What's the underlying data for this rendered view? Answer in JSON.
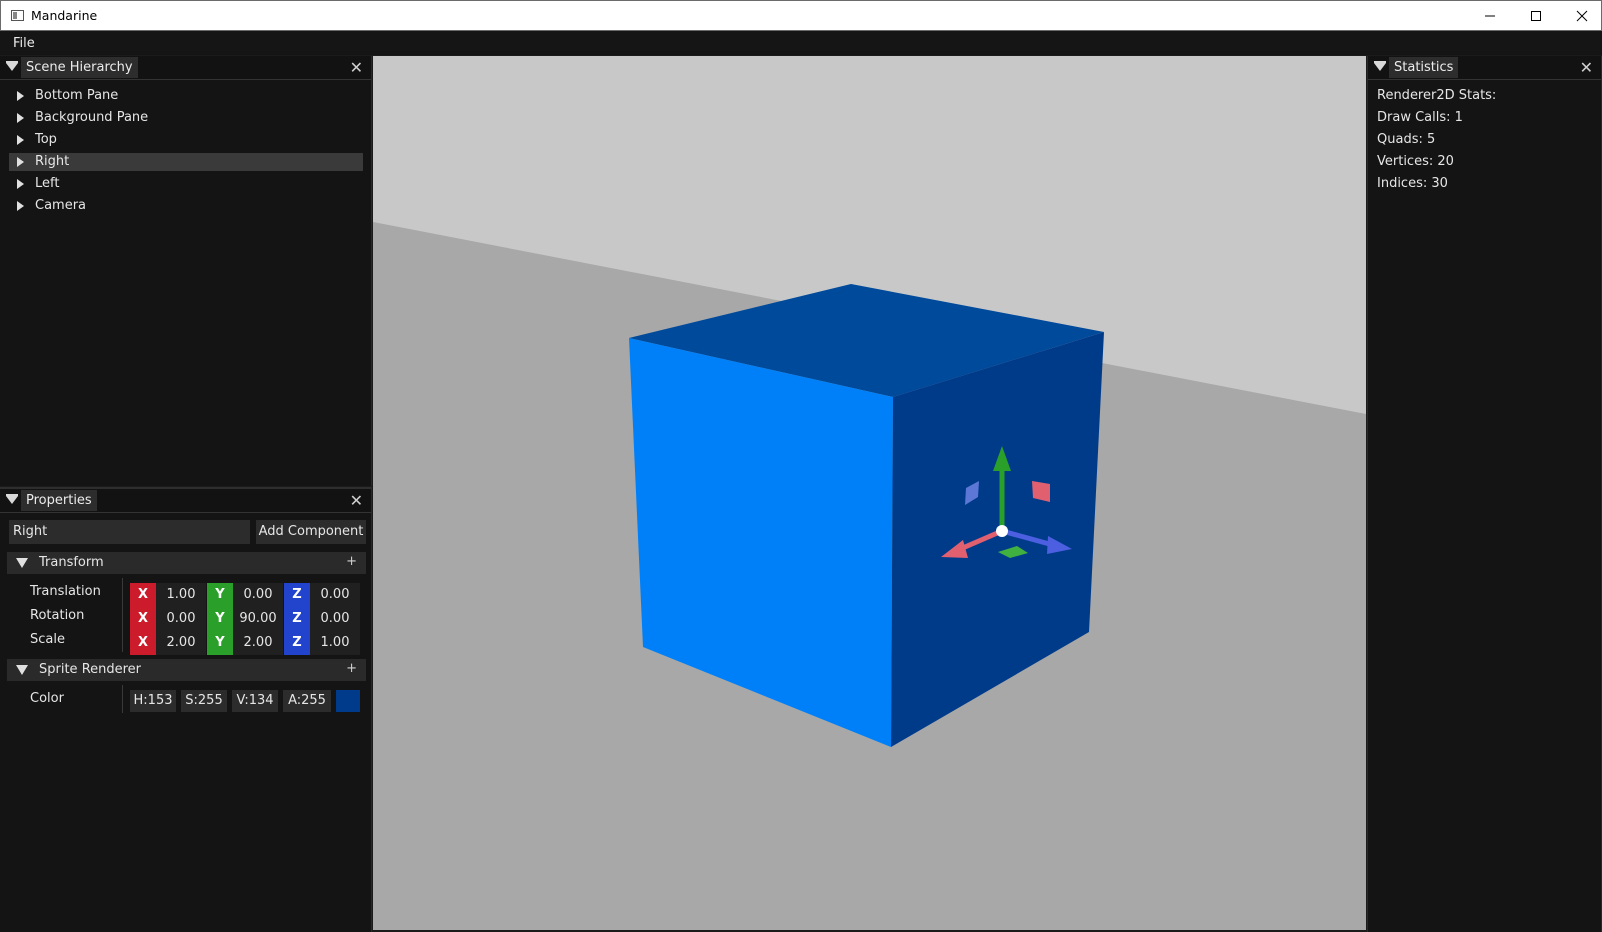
{
  "window": {
    "title": "Mandarine"
  },
  "menu": [
    "File"
  ],
  "scene_hierarchy": {
    "title": "Scene Hierarchy",
    "items": [
      "Bottom Pane",
      "Background Pane",
      "Top",
      "Right",
      "Left",
      "Camera"
    ],
    "selected": "Right"
  },
  "properties": {
    "title": "Properties",
    "entity_name": "Right",
    "add_component": "Add Component",
    "transform": {
      "label": "Transform",
      "plus": "+",
      "axis_labels": [
        "X",
        "Y",
        "Z"
      ],
      "rows": [
        {
          "label": "Translation",
          "x": "1.00",
          "y": "0.00",
          "z": "0.00"
        },
        {
          "label": "Rotation",
          "x": "0.00",
          "y": "90.00",
          "z": "0.00"
        },
        {
          "label": "Scale",
          "x": "2.00",
          "y": "2.00",
          "z": "1.00"
        }
      ]
    },
    "sprite_renderer": {
      "label": "Sprite Renderer",
      "plus": "+",
      "color_label": "Color",
      "h": "H:153",
      "s": "S:255",
      "v": "V:134",
      "a": "A:255",
      "swatch": "#003a8a"
    }
  },
  "statistics": {
    "title": "Statistics",
    "lines": [
      "Renderer2D Stats:",
      "Draw Calls: 1",
      "Quads: 5",
      "Vertices: 20",
      "Indices: 30"
    ]
  },
  "colors": {
    "cube_front": "#0080f8",
    "cube_side": "#003b8a",
    "cube_top": "#004a9c",
    "floor": "#a8a8a8",
    "backwall": "#c8c8c8",
    "axis_x": "#cc1c2c",
    "axis_y": "#2aa02a",
    "axis_z": "#2244cc"
  }
}
